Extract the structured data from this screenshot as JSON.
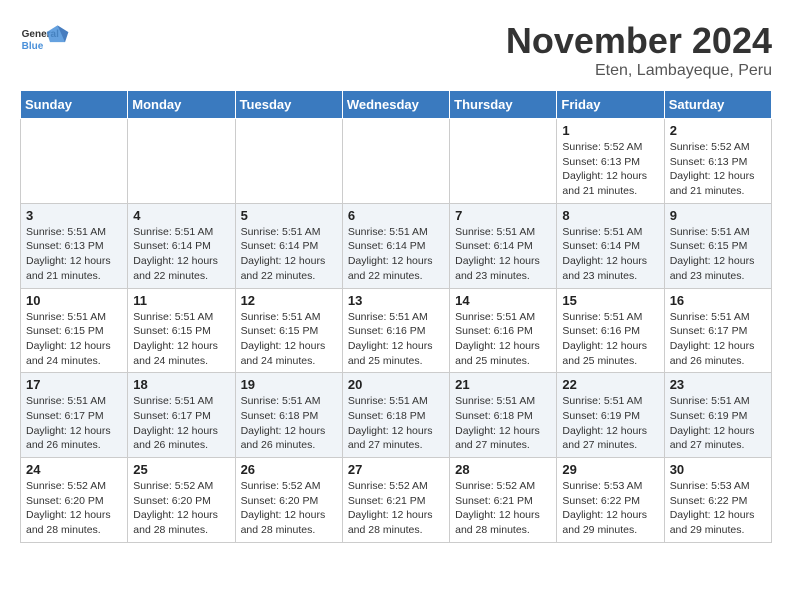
{
  "logo": {
    "text_general": "General",
    "text_blue": "Blue"
  },
  "title": "November 2024",
  "location": "Eten, Lambayeque, Peru",
  "weekdays": [
    "Sunday",
    "Monday",
    "Tuesday",
    "Wednesday",
    "Thursday",
    "Friday",
    "Saturday"
  ],
  "weeks": [
    [
      {
        "day": "",
        "content": ""
      },
      {
        "day": "",
        "content": ""
      },
      {
        "day": "",
        "content": ""
      },
      {
        "day": "",
        "content": ""
      },
      {
        "day": "",
        "content": ""
      },
      {
        "day": "1",
        "content": "Sunrise: 5:52 AM\nSunset: 6:13 PM\nDaylight: 12 hours and 21 minutes."
      },
      {
        "day": "2",
        "content": "Sunrise: 5:52 AM\nSunset: 6:13 PM\nDaylight: 12 hours and 21 minutes."
      }
    ],
    [
      {
        "day": "3",
        "content": "Sunrise: 5:51 AM\nSunset: 6:13 PM\nDaylight: 12 hours and 21 minutes."
      },
      {
        "day": "4",
        "content": "Sunrise: 5:51 AM\nSunset: 6:14 PM\nDaylight: 12 hours and 22 minutes."
      },
      {
        "day": "5",
        "content": "Sunrise: 5:51 AM\nSunset: 6:14 PM\nDaylight: 12 hours and 22 minutes."
      },
      {
        "day": "6",
        "content": "Sunrise: 5:51 AM\nSunset: 6:14 PM\nDaylight: 12 hours and 22 minutes."
      },
      {
        "day": "7",
        "content": "Sunrise: 5:51 AM\nSunset: 6:14 PM\nDaylight: 12 hours and 23 minutes."
      },
      {
        "day": "8",
        "content": "Sunrise: 5:51 AM\nSunset: 6:14 PM\nDaylight: 12 hours and 23 minutes."
      },
      {
        "day": "9",
        "content": "Sunrise: 5:51 AM\nSunset: 6:15 PM\nDaylight: 12 hours and 23 minutes."
      }
    ],
    [
      {
        "day": "10",
        "content": "Sunrise: 5:51 AM\nSunset: 6:15 PM\nDaylight: 12 hours and 24 minutes."
      },
      {
        "day": "11",
        "content": "Sunrise: 5:51 AM\nSunset: 6:15 PM\nDaylight: 12 hours and 24 minutes."
      },
      {
        "day": "12",
        "content": "Sunrise: 5:51 AM\nSunset: 6:15 PM\nDaylight: 12 hours and 24 minutes."
      },
      {
        "day": "13",
        "content": "Sunrise: 5:51 AM\nSunset: 6:16 PM\nDaylight: 12 hours and 25 minutes."
      },
      {
        "day": "14",
        "content": "Sunrise: 5:51 AM\nSunset: 6:16 PM\nDaylight: 12 hours and 25 minutes."
      },
      {
        "day": "15",
        "content": "Sunrise: 5:51 AM\nSunset: 6:16 PM\nDaylight: 12 hours and 25 minutes."
      },
      {
        "day": "16",
        "content": "Sunrise: 5:51 AM\nSunset: 6:17 PM\nDaylight: 12 hours and 26 minutes."
      }
    ],
    [
      {
        "day": "17",
        "content": "Sunrise: 5:51 AM\nSunset: 6:17 PM\nDaylight: 12 hours and 26 minutes."
      },
      {
        "day": "18",
        "content": "Sunrise: 5:51 AM\nSunset: 6:17 PM\nDaylight: 12 hours and 26 minutes."
      },
      {
        "day": "19",
        "content": "Sunrise: 5:51 AM\nSunset: 6:18 PM\nDaylight: 12 hours and 26 minutes."
      },
      {
        "day": "20",
        "content": "Sunrise: 5:51 AM\nSunset: 6:18 PM\nDaylight: 12 hours and 27 minutes."
      },
      {
        "day": "21",
        "content": "Sunrise: 5:51 AM\nSunset: 6:18 PM\nDaylight: 12 hours and 27 minutes."
      },
      {
        "day": "22",
        "content": "Sunrise: 5:51 AM\nSunset: 6:19 PM\nDaylight: 12 hours and 27 minutes."
      },
      {
        "day": "23",
        "content": "Sunrise: 5:51 AM\nSunset: 6:19 PM\nDaylight: 12 hours and 27 minutes."
      }
    ],
    [
      {
        "day": "24",
        "content": "Sunrise: 5:52 AM\nSunset: 6:20 PM\nDaylight: 12 hours and 28 minutes."
      },
      {
        "day": "25",
        "content": "Sunrise: 5:52 AM\nSunset: 6:20 PM\nDaylight: 12 hours and 28 minutes."
      },
      {
        "day": "26",
        "content": "Sunrise: 5:52 AM\nSunset: 6:20 PM\nDaylight: 12 hours and 28 minutes."
      },
      {
        "day": "27",
        "content": "Sunrise: 5:52 AM\nSunset: 6:21 PM\nDaylight: 12 hours and 28 minutes."
      },
      {
        "day": "28",
        "content": "Sunrise: 5:52 AM\nSunset: 6:21 PM\nDaylight: 12 hours and 28 minutes."
      },
      {
        "day": "29",
        "content": "Sunrise: 5:53 AM\nSunset: 6:22 PM\nDaylight: 12 hours and 29 minutes."
      },
      {
        "day": "30",
        "content": "Sunrise: 5:53 AM\nSunset: 6:22 PM\nDaylight: 12 hours and 29 minutes."
      }
    ]
  ]
}
